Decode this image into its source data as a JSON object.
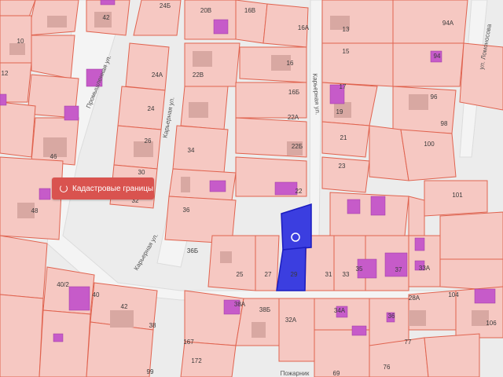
{
  "map": {
    "colors": {
      "background": "#ececec",
      "parcel_fill": "#f6c8c2",
      "parcel_stroke": "#e0634f",
      "building": "#d8a8a2",
      "building_highlight": "#c65bc9",
      "selected_fill": "#3b3ee0",
      "selected_stroke": "#1a1cbf"
    },
    "cadastral_button_label": "Кадастровые границы",
    "streets": [
      {
        "text": "Промышленная ул."
      },
      {
        "text": "Карьерная ул."
      },
      {
        "text": "Карьерная ул."
      },
      {
        "text": "Карьерная ул."
      },
      {
        "text": "ул. Ломоносова"
      },
      {
        "text": "Пожарник"
      }
    ],
    "parcel_labels": [
      "42",
      "24Б",
      "20В",
      "16В",
      "13",
      "94А",
      "10",
      "16А",
      "12",
      "94",
      "24А",
      "22В",
      "15",
      "46",
      "16",
      "24",
      "16Б",
      "17",
      "96",
      "19",
      "26",
      "22А",
      "98",
      "100",
      "34",
      "22Б",
      "21",
      "30",
      "23",
      "32",
      "22",
      "48",
      "36",
      "101",
      "36Б",
      "25",
      "27",
      "29",
      "31",
      "33",
      "35",
      "37",
      "33А",
      "40/2",
      "40",
      "42",
      "38",
      "38А",
      "38Б",
      "32А",
      "34А",
      "36",
      "28А",
      "104",
      "106",
      "167",
      "172",
      "77",
      "69",
      "76",
      "99"
    ]
  }
}
